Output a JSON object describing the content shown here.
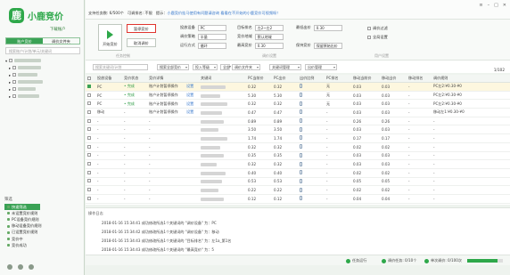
{
  "app": {
    "name": "小鹿竞价",
    "download": "下载账户",
    "support_tip": "支持任务数: 6/500个",
    "bid_count": "可调排名: 不限",
    "tip_prefix": "提示：",
    "tip_link": "小鹿竞价挂马使用有问题请咨询",
    "tip_end": "看看在不开始的小鹿竞价可视频呀！"
  },
  "sidebar": {
    "tabs": [
      "账户竞价",
      "调价文件夹"
    ],
    "search_placeholder": "搜索账户/计划/单元/关键词",
    "filter_head": "筛选",
    "filters": [
      "快速筛选",
      "未设置竞价规则",
      "PC设备竞价规则",
      "移动设备竞价规则",
      "已设置竞价规则",
      "竞价中",
      "竞价成功"
    ]
  },
  "controls": {
    "start": "开始竞价",
    "stop": "暂停竞价",
    "cancel": "取消调价",
    "group1": "任务控制",
    "group2": "调价设置",
    "group3": "用户设置",
    "device_label": "投放设备",
    "device": "PC",
    "strategy_label": "调价策略",
    "strategy": "半量",
    "interval_label": "运行方式",
    "interval": "循环",
    "rank_label": "目标排名",
    "rank": "左2~左2",
    "region_label": "竞价地域",
    "region": "默认地域",
    "maxbid_label": "最高竞价",
    "maxbid": "0.30",
    "minbid_label": "最低出价",
    "minbid": "0.30",
    "keep_label": "保持竞价",
    "keep": "保留原始出价",
    "opt1": "调价过滤",
    "opt2": "全局设置"
  },
  "filter": {
    "search_placeholder": "搜索关键词/计划",
    "f1": "搜索全部竞价",
    "f2": "投入等级",
    "f3": "全部状态",
    "f4": "调价文件夹",
    "f5": "关键词管理",
    "f6": "出价管理",
    "page": "1/102"
  },
  "table": {
    "headers": [
      "",
      "投放设备",
      "竞价状态",
      "竞价详情",
      "",
      "关键词",
      "PC当前价",
      "PC出价",
      "出价比例",
      "PC排名",
      "移动当前价",
      "移动出价",
      "移动排名",
      "调价规则"
    ],
    "rows": [
      {
        "dev": "PC",
        "status": "• 完成",
        "detail": "账户计划暂停操作",
        "op": "设置",
        "cur": "0.32",
        "bid": "0.32",
        "rank": "无",
        "mcur": "0.03",
        "mbid": "0.03",
        "rule": "PC左2:¥0.30-¥0"
      },
      {
        "dev": "PC",
        "status": "• 完成",
        "detail": "账户计划暂停操作",
        "op": "设置",
        "cur": "5.30",
        "bid": "5.30",
        "rank": "无",
        "mcur": "0.03",
        "mbid": "0.03",
        "rule": "PC左2:¥0.30-¥0"
      },
      {
        "dev": "PC",
        "status": "• 完成",
        "detail": "账户计划暂停操作",
        "op": "设置",
        "cur": "0.32",
        "bid": "0.32",
        "rank": "无",
        "mcur": "0.03",
        "mbid": "0.03",
        "rule": "PC左2:¥0.30-¥0"
      },
      {
        "dev": "移动",
        "status": "-",
        "detail": "账户计划暂停操作",
        "op": "设置",
        "cur": "0.47",
        "bid": "0.47",
        "rank": "-",
        "mcur": "0.03",
        "mbid": "0.03",
        "rule": "移动左1:¥0.30-¥0"
      },
      {
        "dev": "-",
        "status": "-",
        "detail": "-",
        "op": "",
        "cur": "0.89",
        "bid": "0.89",
        "rank": "-",
        "mcur": "0.26",
        "mbid": "0.26",
        "rule": "-"
      },
      {
        "dev": "-",
        "status": "-",
        "detail": "-",
        "op": "",
        "cur": "3.50",
        "bid": "3.50",
        "rank": "-",
        "mcur": "0.03",
        "mbid": "0.03",
        "rule": "-"
      },
      {
        "dev": "-",
        "status": "-",
        "detail": "-",
        "op": "",
        "cur": "1.74",
        "bid": "1.74",
        "rank": "-",
        "mcur": "0.17",
        "mbid": "0.17",
        "rule": "-"
      },
      {
        "dev": "-",
        "status": "-",
        "detail": "-",
        "op": "",
        "cur": "0.32",
        "bid": "0.32",
        "rank": "-",
        "mcur": "0.02",
        "mbid": "0.02",
        "rule": "-"
      },
      {
        "dev": "-",
        "status": "-",
        "detail": "-",
        "op": "",
        "cur": "0.35",
        "bid": "0.35",
        "rank": "-",
        "mcur": "0.03",
        "mbid": "0.03",
        "rule": "-"
      },
      {
        "dev": "-",
        "status": "-",
        "detail": "-",
        "op": "",
        "cur": "0.32",
        "bid": "0.32",
        "rank": "-",
        "mcur": "0.03",
        "mbid": "0.03",
        "rule": "-"
      },
      {
        "dev": "-",
        "status": "-",
        "detail": "-",
        "op": "",
        "cur": "0.40",
        "bid": "0.40",
        "rank": "-",
        "mcur": "0.02",
        "mbid": "0.02",
        "rule": "-"
      },
      {
        "dev": "-",
        "status": "-",
        "detail": "-",
        "op": "",
        "cur": "0.53",
        "bid": "0.53",
        "rank": "-",
        "mcur": "0.05",
        "mbid": "0.05",
        "rule": "-"
      },
      {
        "dev": "-",
        "status": "-",
        "detail": "-",
        "op": "",
        "cur": "0.22",
        "bid": "0.22",
        "rank": "-",
        "mcur": "0.02",
        "mbid": "0.02",
        "rule": "-"
      },
      {
        "dev": "-",
        "status": "-",
        "detail": "-",
        "op": "",
        "cur": "0.12",
        "bid": "0.12",
        "rank": "-",
        "mcur": "0.04",
        "mbid": "0.04",
        "rule": "-"
      }
    ]
  },
  "log": {
    "title": "操作日志",
    "lines": [
      "2018-01-16 15:34:41 成功修改所选1个关键词的 \"调价设备\" 为：PC",
      "2018-01-16 15:34:42 成功修改所选1个关键词的 \"调价设备\" 为：移动",
      "2018-01-16 15:34:43 成功修改所选1个关键词的 \"目标排名\" 为：左1a_第1名",
      "2018-01-16 15:34:43 成功修改所选1个关键词的 \"最高竞价\" 为：5"
    ]
  },
  "status": {
    "s1": "任务运行",
    "s2": "调价任务: 0/10个",
    "s3": "单次调价: 0/100次",
    "progress": 0.85
  }
}
